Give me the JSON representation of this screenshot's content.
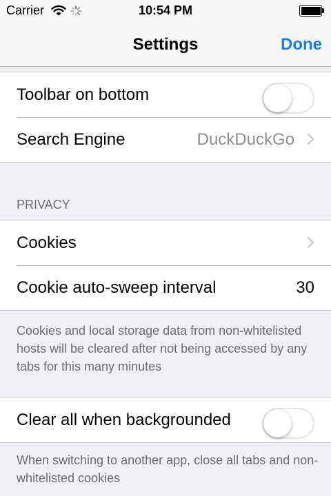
{
  "status_bar": {
    "carrier": "Carrier",
    "time": "10:54 PM",
    "icons": [
      "wifi-icon",
      "activity-spinner-icon",
      "battery-icon"
    ]
  },
  "nav": {
    "title": "Settings",
    "done_label": "Done",
    "accent_color": "#147efb"
  },
  "general": {
    "toolbar_on_bottom": {
      "label": "Toolbar on bottom",
      "enabled": false
    },
    "search_engine": {
      "label": "Search Engine",
      "value": "DuckDuckGo"
    }
  },
  "privacy": {
    "header": "PRIVACY",
    "cookies": {
      "label": "Cookies"
    },
    "auto_sweep": {
      "label": "Cookie auto-sweep interval",
      "value": "30"
    },
    "auto_sweep_footer": "Cookies and local storage data from non-whitelisted hosts will be cleared after not being accessed by any tabs for this many minutes"
  },
  "background": {
    "clear_all": {
      "label": "Clear all when backgrounded",
      "enabled": false
    },
    "footer": "When switching to another app, close all tabs and non-whitelisted cookies"
  }
}
